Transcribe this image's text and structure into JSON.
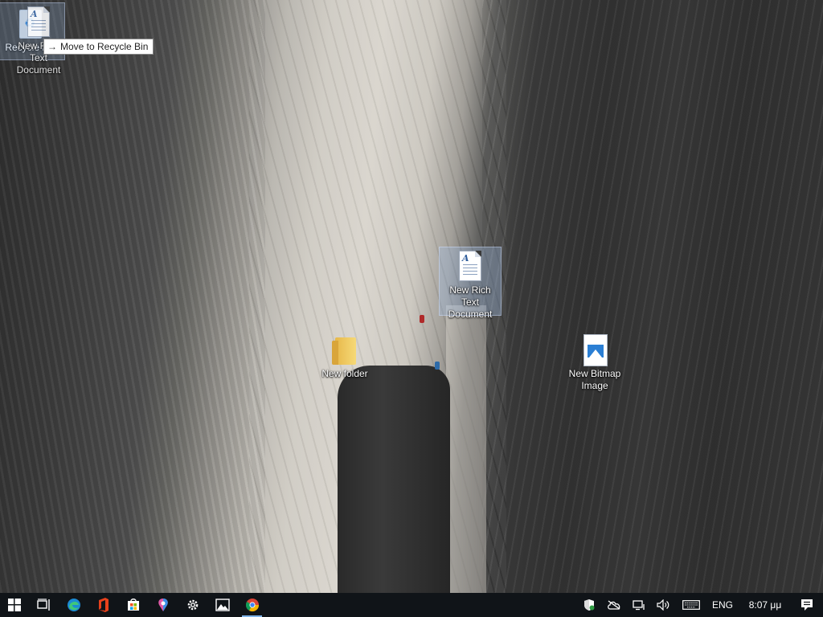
{
  "desktop": {
    "icons": {
      "recycle_bin": {
        "label": "Recycle Bin",
        "icon": "recycle-bin-icon"
      },
      "dragged_file": {
        "label": "New Rich Text Document",
        "icon": "rich-text-document-icon"
      },
      "rich_text": {
        "label": "New Rich Text Document",
        "icon": "rich-text-document-icon"
      },
      "folder": {
        "label": "New folder",
        "icon": "folder-icon"
      },
      "bitmap": {
        "label": "New Bitmap Image",
        "icon": "bitmap-image-icon"
      }
    },
    "drag_tooltip": {
      "action": "Move to Recycle Bin",
      "icon": "arrow-right-icon"
    }
  },
  "taskbar": {
    "buttons": [
      {
        "name": "start",
        "icon": "windows-icon"
      },
      {
        "name": "task-view",
        "icon": "task-view-icon"
      },
      {
        "name": "edge",
        "icon": "edge-icon"
      },
      {
        "name": "office",
        "icon": "office-icon"
      },
      {
        "name": "store",
        "icon": "store-icon"
      },
      {
        "name": "paint3d",
        "icon": "paint3d-icon"
      },
      {
        "name": "settings",
        "icon": "gear-icon"
      },
      {
        "name": "photos",
        "icon": "photos-icon"
      },
      {
        "name": "chrome",
        "icon": "chrome-icon",
        "active": true
      }
    ],
    "tray": {
      "language": "ENG",
      "clock": "8:07 μμ",
      "icons": [
        "shield-icon",
        "cloud-icon",
        "network-icon",
        "volume-icon",
        "keyboard-icon",
        "notification-icon"
      ]
    }
  },
  "colors": {
    "taskbar_bg": "#101418",
    "selection": "#a0bee6",
    "accent": "#7fb4e8"
  }
}
